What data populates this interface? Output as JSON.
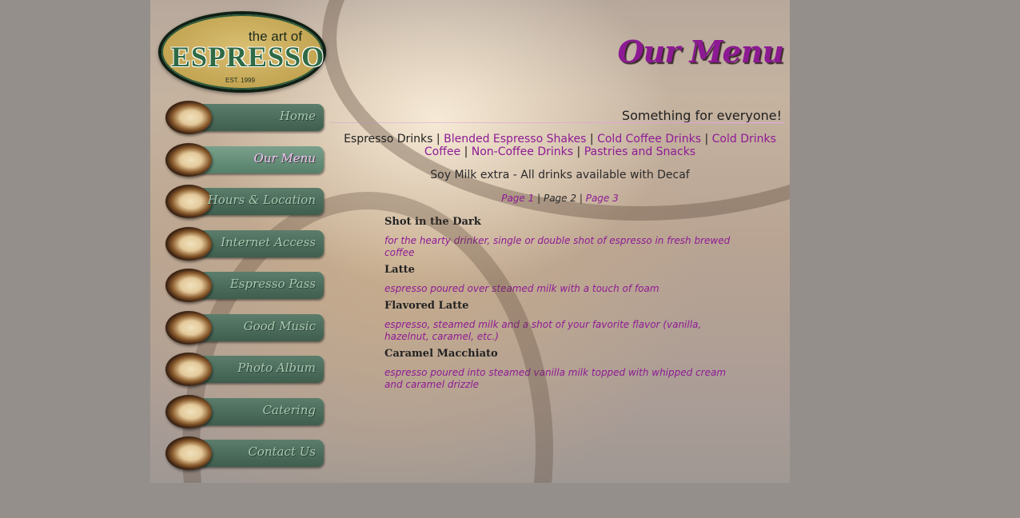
{
  "colors": {
    "accent": "#8e1a95",
    "nav_green": "#4d6e5c",
    "background": "#958f8b"
  },
  "logo": {
    "art": "the art of",
    "main": "ESPRESSO",
    "est": "EST. 1999"
  },
  "nav": [
    {
      "label": "Home",
      "icon": "coffee-cup-icon"
    },
    {
      "label": "Our Menu",
      "icon": "coffee-cup-icon",
      "active": true
    },
    {
      "label": "Hours & Location",
      "icon": "coffee-cup-icon"
    },
    {
      "label": "Internet Access",
      "icon": "coffee-cup-icon"
    },
    {
      "label": "Espresso Pass",
      "icon": "coffee-cup-icon"
    },
    {
      "label": "Good Music",
      "icon": "coffee-cup-icon"
    },
    {
      "label": "Photo Album",
      "icon": "coffee-cup-icon"
    },
    {
      "label": "Catering",
      "icon": "coffee-cup-icon"
    },
    {
      "label": "Contact Us",
      "icon": "coffee-cup-icon"
    }
  ],
  "page": {
    "title": "Our Menu",
    "tagline": "Something for everyone!",
    "categories": {
      "current": "Espresso Drinks",
      "links": [
        "Blended Espresso Shakes",
        "Cold Coffee Drinks",
        "Cold Drinks Coffee",
        "Non-Coffee Drinks",
        "Pastries and Snacks"
      ],
      "separator": "|"
    },
    "soy_note": "Soy Milk extra - All drinks available with Decaf",
    "pager": {
      "page1": "Page 1",
      "page2": "Page 2",
      "page3": "Page 3",
      "separator": "|"
    }
  },
  "menu_items": [
    {
      "name": "Shot in the Dark",
      "desc": "for the hearty drinker, single or double shot of espresso in fresh brewed coffee"
    },
    {
      "name": "Latte",
      "desc": "espresso poured over steamed milk with a touch of foam"
    },
    {
      "name": "Flavored Latte",
      "desc": "espresso, steamed milk and a shot of your favorite flavor (vanilla, hazelnut, caramel, etc.)"
    },
    {
      "name": "Caramel Macchiato",
      "desc": "espresso poured into steamed vanilla milk topped with whipped cream and caramel drizzle"
    }
  ]
}
